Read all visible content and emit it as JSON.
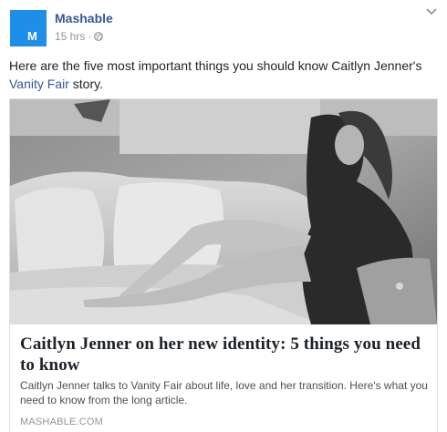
{
  "post": {
    "page_name": "Mashable",
    "avatar_letter": "M",
    "timestamp": "15 hrs",
    "separator": "·",
    "privacy_icon": "globe-icon",
    "menu_icon": "chevron-down-icon",
    "text_before": "Here are the five most important things you should know Caitlyn Jenner's ",
    "text_link": "Vanity Fair",
    "text_after": " story."
  },
  "link_card": {
    "title": "Caitlyn Jenner on her new identity: 5 things you need to know",
    "description": "Caitlyn Jenner talks to Vanity Fair about life, love and her transition. Here's what you need to know from the long article.",
    "domain": "MASHABLE.COM"
  },
  "colors": {
    "brand_blue": "#1f8ee8",
    "link_blue": "#365899",
    "meta_gray": "#90949c"
  }
}
